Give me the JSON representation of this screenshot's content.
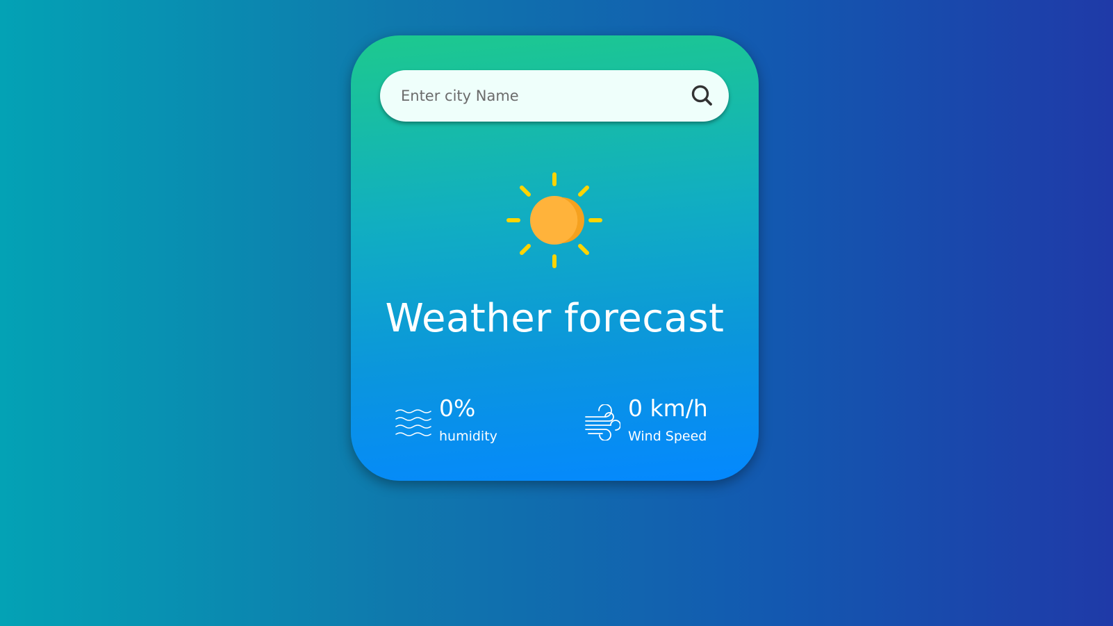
{
  "search": {
    "placeholder": "Enter city Name",
    "value": "",
    "icon": "search-icon"
  },
  "weather": {
    "icon": "sun-icon",
    "title": "Weather forecast"
  },
  "humidity": {
    "icon": "waves-icon",
    "value": "0%",
    "label": "humidity"
  },
  "wind": {
    "icon": "wind-icon",
    "value": "0 km/h",
    "label": "Wind Speed"
  },
  "colors": {
    "background_start": "#03a2b5",
    "background_end": "#1f3aa8",
    "card_top": "#1dc98e",
    "card_bottom": "#0488ff",
    "search_bg": "#effffb",
    "sun_core": "#ffb33b",
    "sun_rays": "#ffd400",
    "text": "#ffffff"
  }
}
